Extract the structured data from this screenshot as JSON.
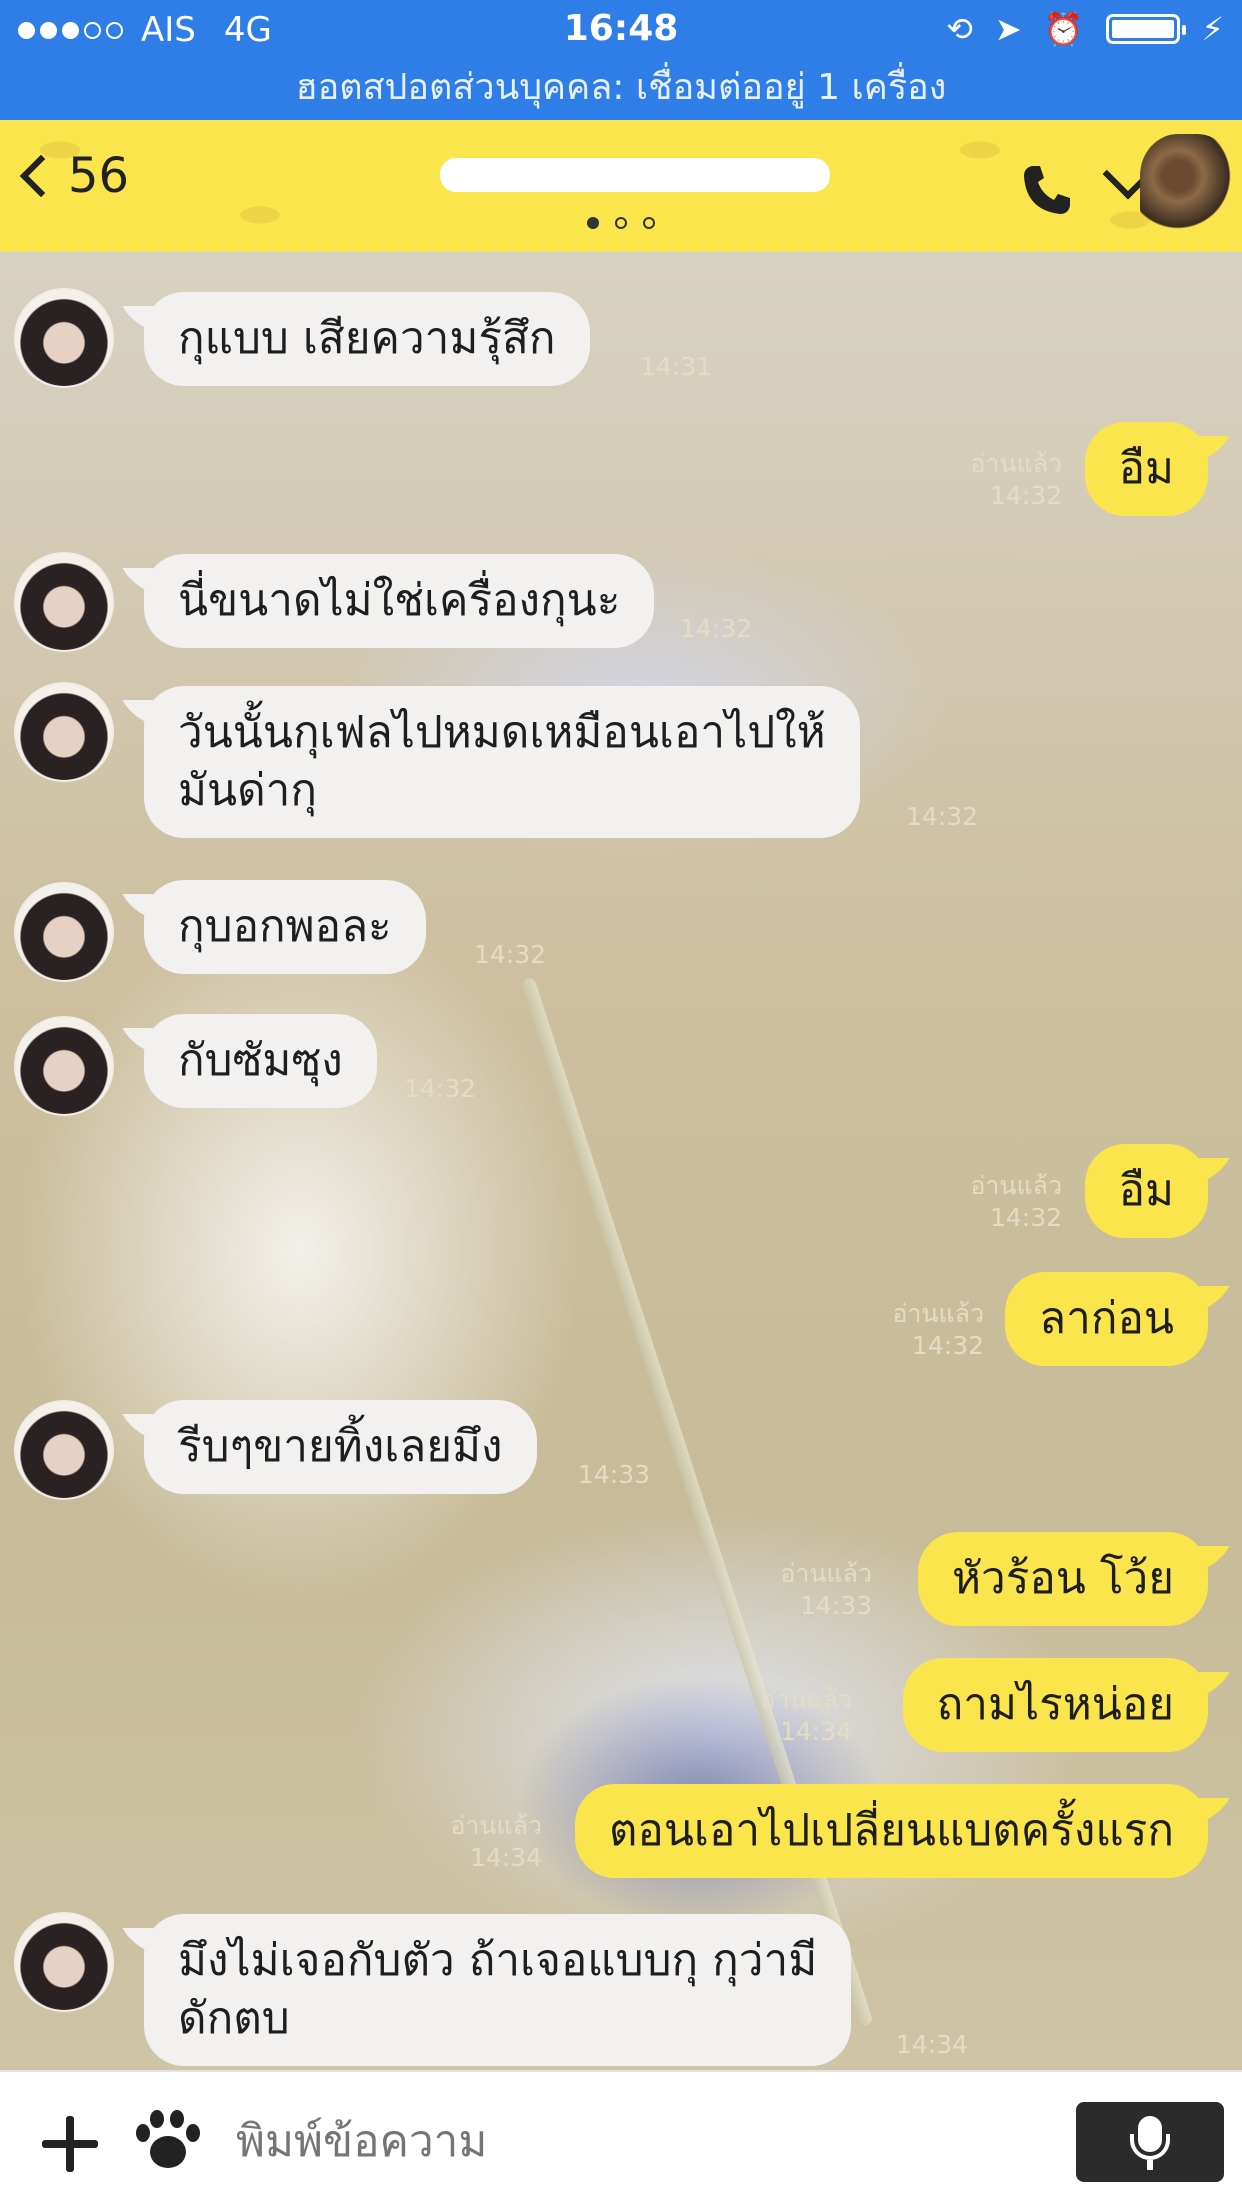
{
  "status_bar": {
    "carrier": "AIS",
    "network": "4G",
    "time": "16:48",
    "signal_strength": 3,
    "battery": "full, charging"
  },
  "hotspot_banner": "ฮอตสปอตส่วนบุคคล: เชื่อมต่ออยู่ 1 เครื่อง",
  "header": {
    "back_count": "56",
    "chat_name": "",
    "page_indicator": {
      "count": 3,
      "active": 0
    },
    "icons": [
      "back-chevron-icon",
      "phone-icon",
      "menu-chevron-icon",
      "profile-avatar"
    ]
  },
  "messages": [
    {
      "side": "in",
      "text": "กุแบบ เสียความรุ้สึก",
      "time": "14:31"
    },
    {
      "side": "out",
      "text": "อืม",
      "read": "อ่านแล้ว",
      "time": "14:32"
    },
    {
      "side": "in",
      "text": "นี่ขนาดไม่ใช่เครื่องกุนะ",
      "time": "14:32"
    },
    {
      "side": "in",
      "text": "วันนั้นกุเฟลไปหมดเหมือนเอาไปให้\nมันด่ากุ",
      "time": "14:32"
    },
    {
      "side": "in",
      "text": "กุบอกพอละ",
      "time": "14:32"
    },
    {
      "side": "in",
      "text": "กับซัมซุง",
      "time": "14:32"
    },
    {
      "side": "out",
      "text": "อืม",
      "read": "อ่านแล้ว",
      "time": "14:32"
    },
    {
      "side": "out",
      "text": "ลาก่อน",
      "read": "อ่านแล้ว",
      "time": "14:32"
    },
    {
      "side": "in",
      "text": "รีบๆขายทิ้งเลยมึง",
      "time": "14:33"
    },
    {
      "side": "out",
      "text": "หัวร้อน โว้ย",
      "read": "อ่านแล้ว",
      "time": "14:33"
    },
    {
      "side": "out",
      "text": "ถามไรหน่อย",
      "read": "อ่านแล้ว",
      "time": "14:34"
    },
    {
      "side": "out",
      "text": "ตอนเอาไปเปลี่ยนแบตครั้งแรก",
      "read": "อ่านแล้ว",
      "time": "14:34"
    },
    {
      "side": "in",
      "text": "มึงไม่เจอกับตัว ถ้าเจอแบบกุ กุว่ามี\nดักตบ",
      "time": "14:34"
    }
  ],
  "input_bar": {
    "placeholder": "พิมพ์ข้อความ",
    "icons": [
      "plus-icon",
      "paw-icon",
      "microphone-icon"
    ]
  },
  "colors": {
    "status_bar": "#2f7de6",
    "header": "#fbe54d",
    "outgoing_bubble": "#fbe54d",
    "incoming_bubble": "#f2f1f0",
    "mic_button": "#2b2b2b"
  }
}
